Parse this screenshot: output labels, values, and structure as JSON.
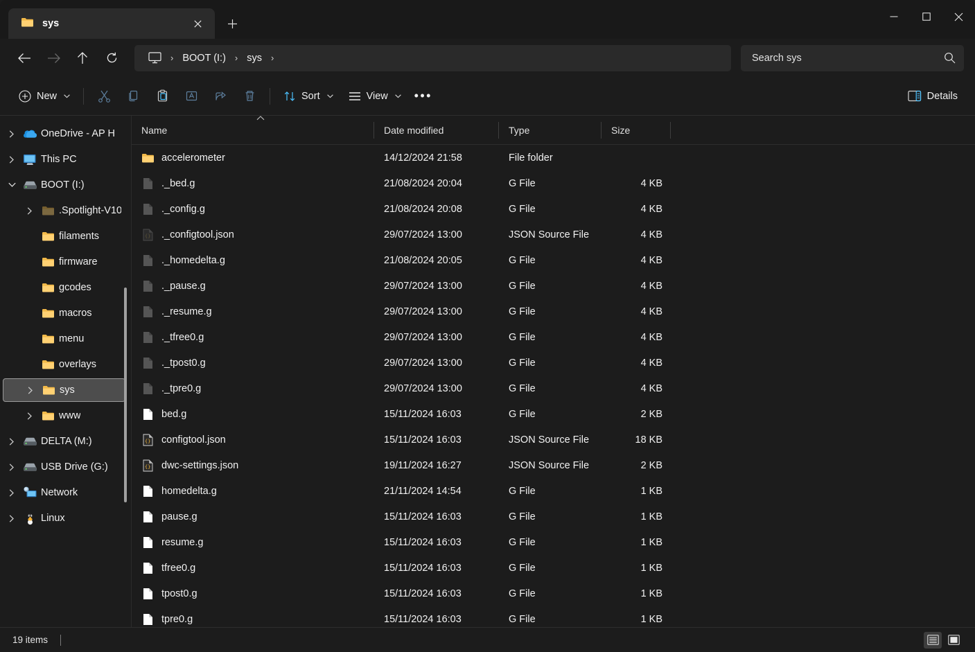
{
  "window": {
    "tab": {
      "title": "sys",
      "icon": "folder-icon",
      "close_label": "✕"
    },
    "new_tab_label": "+",
    "controls": {
      "minimize": "minimize-icon",
      "maximize": "maximize-icon",
      "close": "close-icon"
    }
  },
  "address": {
    "back": "back-arrow-icon",
    "forward": "forward-arrow-icon",
    "up": "up-arrow-icon",
    "refresh": "refresh-icon",
    "breadcrumb": [
      {
        "label": "",
        "icon": "this-pc-icon"
      },
      {
        "label": "BOOT (I:)",
        "icon": ""
      },
      {
        "label": "sys",
        "icon": ""
      }
    ],
    "separator": "›"
  },
  "search": {
    "placeholder": "Search sys",
    "value": "Search sys",
    "icon": "search-icon"
  },
  "toolbar": {
    "new_label": "New",
    "cut_label": "Cut",
    "copy_label": "Copy",
    "paste_label": "Paste",
    "rename_label": "Rename",
    "share_label": "Share",
    "delete_label": "Delete",
    "sort_label": "Sort",
    "view_label": "View",
    "more_label": "•••",
    "details_label": "Details",
    "chevron": "⌄"
  },
  "sidebar": {
    "items": [
      {
        "label": "OneDrive - AP H",
        "icon": "onedrive-icon",
        "level": 1,
        "twisty": "collapsed",
        "selected": false,
        "dim": false
      },
      {
        "label": "This PC",
        "icon": "this-pc-icon",
        "level": 1,
        "twisty": "collapsed",
        "selected": false,
        "dim": false
      },
      {
        "label": "BOOT (I:)",
        "icon": "drive-icon",
        "level": 1,
        "twisty": "expanded",
        "selected": false,
        "dim": false
      },
      {
        "label": ".Spotlight-V10",
        "icon": "folder-icon",
        "level": 2,
        "twisty": "collapsed",
        "selected": false,
        "dim": true
      },
      {
        "label": "filaments",
        "icon": "folder-icon",
        "level": 2,
        "twisty": "none",
        "selected": false,
        "dim": false
      },
      {
        "label": "firmware",
        "icon": "folder-icon",
        "level": 2,
        "twisty": "none",
        "selected": false,
        "dim": false
      },
      {
        "label": "gcodes",
        "icon": "folder-icon",
        "level": 2,
        "twisty": "none",
        "selected": false,
        "dim": false
      },
      {
        "label": "macros",
        "icon": "folder-icon",
        "level": 2,
        "twisty": "none",
        "selected": false,
        "dim": false
      },
      {
        "label": "menu",
        "icon": "folder-icon",
        "level": 2,
        "twisty": "none",
        "selected": false,
        "dim": false
      },
      {
        "label": "overlays",
        "icon": "folder-icon",
        "level": 2,
        "twisty": "none",
        "selected": false,
        "dim": false
      },
      {
        "label": "sys",
        "icon": "folder-icon",
        "level": 2,
        "twisty": "collapsed",
        "selected": true,
        "dim": false
      },
      {
        "label": "www",
        "icon": "folder-icon",
        "level": 2,
        "twisty": "collapsed",
        "selected": false,
        "dim": false
      },
      {
        "label": "DELTA (M:)",
        "icon": "drive-icon",
        "level": 1,
        "twisty": "collapsed",
        "selected": false,
        "dim": false
      },
      {
        "label": "USB Drive (G:)",
        "icon": "drive-icon",
        "level": 1,
        "twisty": "collapsed",
        "selected": false,
        "dim": false
      },
      {
        "label": "Network",
        "icon": "network-icon",
        "level": 1,
        "twisty": "collapsed",
        "selected": false,
        "dim": false
      },
      {
        "label": "Linux",
        "icon": "linux-icon",
        "level": 1,
        "twisty": "collapsed",
        "selected": false,
        "dim": false
      }
    ]
  },
  "filelist": {
    "columns": [
      "Name",
      "Date modified",
      "Type",
      "Size"
    ],
    "sort_column": "Name",
    "sort_direction": "ascending",
    "rows": [
      {
        "name": "accelerometer",
        "date": "14/12/2024 21:58",
        "type": "File folder",
        "size": "",
        "icon": "folder-icon",
        "dim": false
      },
      {
        "name": "._bed.g",
        "date": "21/08/2024 20:04",
        "type": "G File",
        "size": "4 KB",
        "icon": "file-icon",
        "dim": true
      },
      {
        "name": "._config.g",
        "date": "21/08/2024 20:08",
        "type": "G File",
        "size": "4 KB",
        "icon": "file-icon",
        "dim": true
      },
      {
        "name": "._configtool.json",
        "date": "29/07/2024 13:00",
        "type": "JSON Source File",
        "size": "4 KB",
        "icon": "json-icon",
        "dim": true
      },
      {
        "name": "._homedelta.g",
        "date": "21/08/2024 20:05",
        "type": "G File",
        "size": "4 KB",
        "icon": "file-icon",
        "dim": true
      },
      {
        "name": "._pause.g",
        "date": "29/07/2024 13:00",
        "type": "G File",
        "size": "4 KB",
        "icon": "file-icon",
        "dim": true
      },
      {
        "name": "._resume.g",
        "date": "29/07/2024 13:00",
        "type": "G File",
        "size": "4 KB",
        "icon": "file-icon",
        "dim": true
      },
      {
        "name": "._tfree0.g",
        "date": "29/07/2024 13:00",
        "type": "G File",
        "size": "4 KB",
        "icon": "file-icon",
        "dim": true
      },
      {
        "name": "._tpost0.g",
        "date": "29/07/2024 13:00",
        "type": "G File",
        "size": "4 KB",
        "icon": "file-icon",
        "dim": true
      },
      {
        "name": "._tpre0.g",
        "date": "29/07/2024 13:00",
        "type": "G File",
        "size": "4 KB",
        "icon": "file-icon",
        "dim": true
      },
      {
        "name": "bed.g",
        "date": "15/11/2024 16:03",
        "type": "G File",
        "size": "2 KB",
        "icon": "file-icon",
        "dim": false
      },
      {
        "name": "configtool.json",
        "date": "15/11/2024 16:03",
        "type": "JSON Source File",
        "size": "18 KB",
        "icon": "json-icon",
        "dim": false
      },
      {
        "name": "dwc-settings.json",
        "date": "19/11/2024 16:27",
        "type": "JSON Source File",
        "size": "2 KB",
        "icon": "json-icon",
        "dim": false
      },
      {
        "name": "homedelta.g",
        "date": "21/11/2024 14:54",
        "type": "G File",
        "size": "1 KB",
        "icon": "file-icon",
        "dim": false
      },
      {
        "name": "pause.g",
        "date": "15/11/2024 16:03",
        "type": "G File",
        "size": "1 KB",
        "icon": "file-icon",
        "dim": false
      },
      {
        "name": "resume.g",
        "date": "15/11/2024 16:03",
        "type": "G File",
        "size": "1 KB",
        "icon": "file-icon",
        "dim": false
      },
      {
        "name": "tfree0.g",
        "date": "15/11/2024 16:03",
        "type": "G File",
        "size": "1 KB",
        "icon": "file-icon",
        "dim": false
      },
      {
        "name": "tpost0.g",
        "date": "15/11/2024 16:03",
        "type": "G File",
        "size": "1 KB",
        "icon": "file-icon",
        "dim": false
      },
      {
        "name": "tpre0.g",
        "date": "15/11/2024 16:03",
        "type": "G File",
        "size": "1 KB",
        "icon": "file-icon",
        "dim": false
      }
    ]
  },
  "statusbar": {
    "item_count": "19 items",
    "view_details": "details-view-icon",
    "view_large_icons": "large-icons-view-icon"
  },
  "colors": {
    "window_bg": "#1c1c1c",
    "titlebar_bg": "#191919",
    "tab_bg": "#2b2b2b",
    "field_bg": "#2a2a2a",
    "selection_bg": "#4d4d4d",
    "selection_border": "#9a9a9a",
    "accent_blue": "#4cc2ff",
    "folder_yellow": "#f0c060",
    "text_primary": "#f1f1f1"
  }
}
